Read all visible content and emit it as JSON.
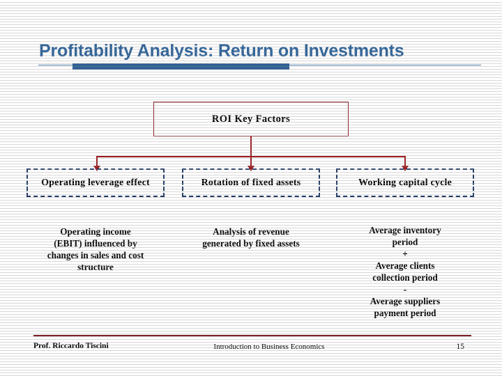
{
  "slide": {
    "title": "Profitability Analysis: Return on Investments",
    "accent_blue": "#2e6399",
    "connector_red": "#9c1b1f",
    "node_border_red": "#8c1f22",
    "dashed_navy": "#1f3864"
  },
  "diagram": {
    "root": {
      "label": "ROI Key Factors"
    },
    "factors": [
      {
        "label": "Operating leverage effect",
        "description_lines": [
          "Operating income",
          "(EBIT) influenced by",
          "changes in sales and cost",
          "structure"
        ]
      },
      {
        "label": "Rotation of fixed assets",
        "description_lines": [
          "Analysis of revenue",
          "generated by fixed assets"
        ]
      },
      {
        "label": "Working capital cycle",
        "description_lines": [
          "Average inventory",
          "period",
          "+",
          "Average clients",
          "collection period",
          "-",
          "Average suppliers",
          "payment period"
        ]
      }
    ]
  },
  "footer": {
    "author": "Prof. Riccardo Tiscini",
    "course": "Introduction to Business Economics",
    "page_number": "15"
  }
}
